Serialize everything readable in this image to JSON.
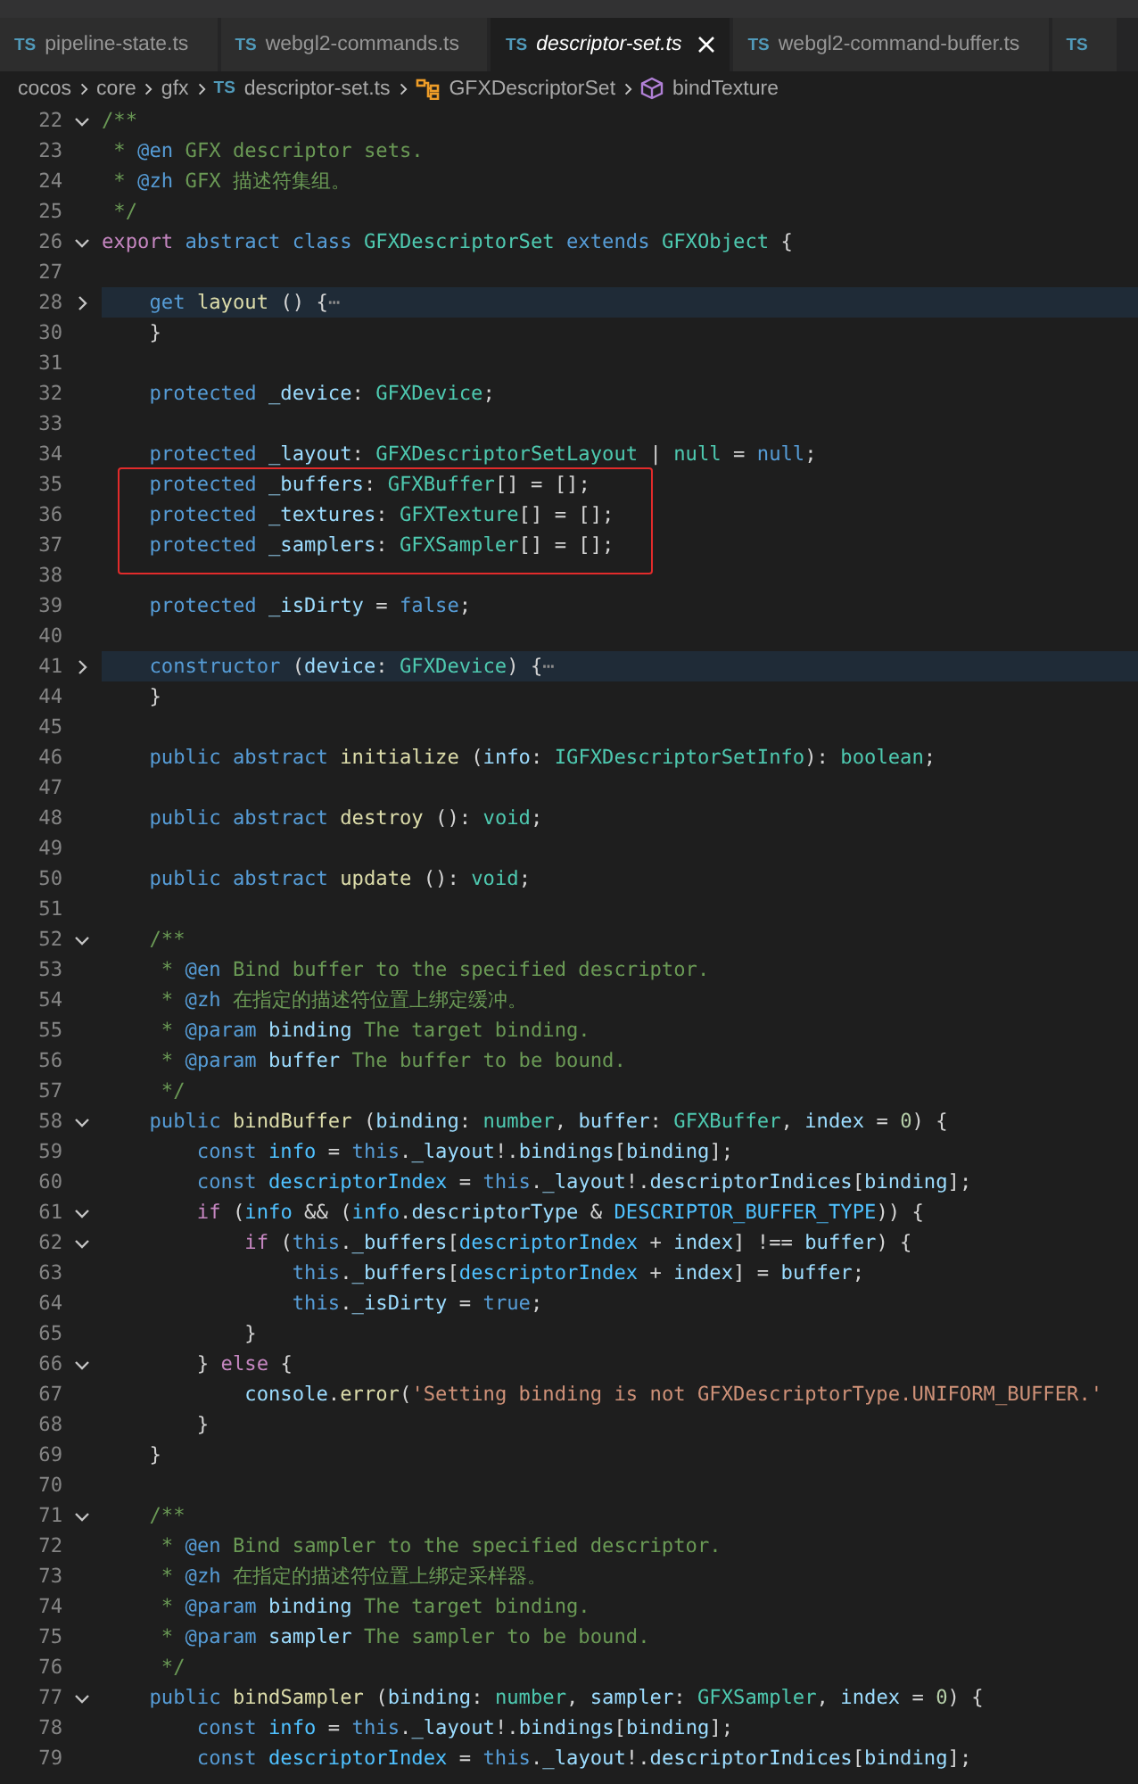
{
  "tabs": [
    {
      "icon": "TS",
      "label": "pipeline-state.ts",
      "selected": false,
      "preview": false
    },
    {
      "icon": "TS",
      "label": "webgl2-commands.ts",
      "selected": false,
      "preview": false
    },
    {
      "icon": "TS",
      "label": "descriptor-set.ts",
      "selected": true,
      "preview": true
    },
    {
      "icon": "TS",
      "label": "webgl2-command-buffer.ts",
      "selected": false,
      "preview": false
    },
    {
      "icon": "TS",
      "selected": false,
      "preview": false
    }
  ],
  "breadcrumb": [
    {
      "kind": "folder",
      "label": "cocos"
    },
    {
      "kind": "folder",
      "label": "core"
    },
    {
      "kind": "folder",
      "label": "gfx"
    },
    {
      "kind": "file",
      "icon": "TS",
      "label": "descriptor-set.ts"
    },
    {
      "kind": "class",
      "label": "GFXDescriptorSet"
    },
    {
      "kind": "method",
      "label": "bindTexture"
    }
  ],
  "lines": [
    {
      "number": "22",
      "expanded": true,
      "tokens": [
        {
          "kind": "comment",
          "text": "/**"
        }
      ]
    },
    {
      "number": "23",
      "tokens": [
        {
          "kind": "comment",
          "text": " * "
        },
        {
          "kind": "doctag",
          "text": "@en"
        },
        {
          "kind": "comment",
          "text": " GFX descriptor sets."
        }
      ]
    },
    {
      "number": "24",
      "tokens": [
        {
          "kind": "comment",
          "text": " * "
        },
        {
          "kind": "doctag",
          "text": "@zh"
        },
        {
          "kind": "comment",
          "text": " GFX 描述符集组。"
        }
      ]
    },
    {
      "number": "25",
      "tokens": [
        {
          "kind": "comment",
          "text": " */"
        }
      ]
    },
    {
      "number": "26",
      "expanded": true,
      "tokens": [
        {
          "kind": "control",
          "text": "export"
        },
        {
          "kind": "keyword",
          "text": " abstract"
        },
        {
          "kind": "keyword",
          "text": " class"
        },
        {
          "kind": "type",
          "text": " GFXDescriptorSet"
        },
        {
          "kind": "keyword",
          "text": " extends"
        },
        {
          "kind": "type",
          "text": " GFXObject"
        },
        {
          "kind": "plain",
          "text": " {"
        }
      ]
    },
    {
      "number": "27"
    },
    {
      "number": "28",
      "expanded": false,
      "highlighted": true,
      "tokens": [
        {
          "kind": "keyword",
          "text": "    get"
        },
        {
          "kind": "function",
          "text": " layout"
        },
        {
          "kind": "plain",
          "text": " () {"
        },
        {
          "kind": "folded",
          "text": "⋯"
        }
      ]
    },
    {
      "number": "30",
      "tokens": [
        {
          "kind": "plain",
          "text": "    }"
        }
      ]
    },
    {
      "number": "31"
    },
    {
      "number": "32",
      "tokens": [
        {
          "kind": "keyword",
          "text": "    protected"
        },
        {
          "kind": "variable",
          "text": " _device"
        },
        {
          "kind": "plain",
          "text": ": "
        },
        {
          "kind": "type",
          "text": "GFXDevice"
        },
        {
          "kind": "plain",
          "text": ";"
        }
      ]
    },
    {
      "number": "33"
    },
    {
      "number": "34",
      "tokens": [
        {
          "kind": "keyword",
          "text": "    protected"
        },
        {
          "kind": "variable",
          "text": " _layout"
        },
        {
          "kind": "plain",
          "text": ": "
        },
        {
          "kind": "type",
          "text": "GFXDescriptorSetLayout"
        },
        {
          "kind": "plain",
          "text": " | "
        },
        {
          "kind": "type",
          "text": "null"
        },
        {
          "kind": "plain",
          "text": " = "
        },
        {
          "kind": "keyword",
          "text": "null"
        },
        {
          "kind": "plain",
          "text": ";"
        }
      ]
    },
    {
      "number": "35",
      "boxed": true,
      "tokens": [
        {
          "kind": "keyword",
          "text": "    protected"
        },
        {
          "kind": "variable",
          "text": " _buffers"
        },
        {
          "kind": "plain",
          "text": ": "
        },
        {
          "kind": "type",
          "text": "GFXBuffer"
        },
        {
          "kind": "plain",
          "text": "[] = [];"
        }
      ]
    },
    {
      "number": "36",
      "boxed": true,
      "tokens": [
        {
          "kind": "keyword",
          "text": "    protected"
        },
        {
          "kind": "variable",
          "text": " _textures"
        },
        {
          "kind": "plain",
          "text": ": "
        },
        {
          "kind": "type",
          "text": "GFXTexture"
        },
        {
          "kind": "plain",
          "text": "[] = [];"
        }
      ]
    },
    {
      "number": "37",
      "boxed": true,
      "tokens": [
        {
          "kind": "keyword",
          "text": "    protected"
        },
        {
          "kind": "variable",
          "text": " _samplers"
        },
        {
          "kind": "plain",
          "text": ": "
        },
        {
          "kind": "type",
          "text": "GFXSampler"
        },
        {
          "kind": "plain",
          "text": "[] = [];"
        }
      ]
    },
    {
      "number": "38"
    },
    {
      "number": "39",
      "tokens": [
        {
          "kind": "keyword",
          "text": "    protected"
        },
        {
          "kind": "variable",
          "text": " _isDirty"
        },
        {
          "kind": "plain",
          "text": " = "
        },
        {
          "kind": "keyword",
          "text": "false"
        },
        {
          "kind": "plain",
          "text": ";"
        }
      ]
    },
    {
      "number": "40"
    },
    {
      "number": "41",
      "expanded": false,
      "highlighted": true,
      "tokens": [
        {
          "kind": "keyword",
          "text": "    constructor"
        },
        {
          "kind": "plain",
          "text": " ("
        },
        {
          "kind": "variable",
          "text": "device"
        },
        {
          "kind": "plain",
          "text": ": "
        },
        {
          "kind": "type",
          "text": "GFXDevice"
        },
        {
          "kind": "plain",
          "text": ") {"
        },
        {
          "kind": "folded",
          "text": "⋯"
        }
      ]
    },
    {
      "number": "44",
      "tokens": [
        {
          "kind": "plain",
          "text": "    }"
        }
      ]
    },
    {
      "number": "45"
    },
    {
      "number": "46",
      "tokens": [
        {
          "kind": "keyword",
          "text": "    public"
        },
        {
          "kind": "keyword",
          "text": " abstract"
        },
        {
          "kind": "function",
          "text": " initialize"
        },
        {
          "kind": "plain",
          "text": " ("
        },
        {
          "kind": "variable",
          "text": "info"
        },
        {
          "kind": "plain",
          "text": ": "
        },
        {
          "kind": "type",
          "text": "IGFXDescriptorSetInfo"
        },
        {
          "kind": "plain",
          "text": "): "
        },
        {
          "kind": "type",
          "text": "boolean"
        },
        {
          "kind": "plain",
          "text": ";"
        }
      ]
    },
    {
      "number": "47"
    },
    {
      "number": "48",
      "tokens": [
        {
          "kind": "keyword",
          "text": "    public"
        },
        {
          "kind": "keyword",
          "text": " abstract"
        },
        {
          "kind": "function",
          "text": " destroy"
        },
        {
          "kind": "plain",
          "text": " (): "
        },
        {
          "kind": "type",
          "text": "void"
        },
        {
          "kind": "plain",
          "text": ";"
        }
      ]
    },
    {
      "number": "49"
    },
    {
      "number": "50",
      "tokens": [
        {
          "kind": "keyword",
          "text": "    public"
        },
        {
          "kind": "keyword",
          "text": " abstract"
        },
        {
          "kind": "function",
          "text": " update"
        },
        {
          "kind": "plain",
          "text": " (): "
        },
        {
          "kind": "type",
          "text": "void"
        },
        {
          "kind": "plain",
          "text": ";"
        }
      ]
    },
    {
      "number": "51"
    },
    {
      "number": "52",
      "expanded": true,
      "tokens": [
        {
          "kind": "comment",
          "text": "    /**"
        }
      ]
    },
    {
      "number": "53",
      "tokens": [
        {
          "kind": "comment",
          "text": "     * "
        },
        {
          "kind": "doctag",
          "text": "@en"
        },
        {
          "kind": "comment",
          "text": " Bind buffer to the specified descriptor."
        }
      ]
    },
    {
      "number": "54",
      "tokens": [
        {
          "kind": "comment",
          "text": "     * "
        },
        {
          "kind": "doctag",
          "text": "@zh"
        },
        {
          "kind": "comment",
          "text": " 在指定的描述符位置上绑定缓冲。"
        }
      ]
    },
    {
      "number": "55",
      "tokens": [
        {
          "kind": "comment",
          "text": "     * "
        },
        {
          "kind": "doctag",
          "text": "@param"
        },
        {
          "kind": "variable",
          "text": " binding"
        },
        {
          "kind": "comment",
          "text": " The target binding."
        }
      ]
    },
    {
      "number": "56",
      "tokens": [
        {
          "kind": "comment",
          "text": "     * "
        },
        {
          "kind": "doctag",
          "text": "@param"
        },
        {
          "kind": "variable",
          "text": " buffer"
        },
        {
          "kind": "comment",
          "text": " The buffer to be bound."
        }
      ]
    },
    {
      "number": "57",
      "tokens": [
        {
          "kind": "comment",
          "text": "     */"
        }
      ]
    },
    {
      "number": "58",
      "expanded": true,
      "tokens": [
        {
          "kind": "keyword",
          "text": "    public"
        },
        {
          "kind": "function",
          "text": " bindBuffer"
        },
        {
          "kind": "plain",
          "text": " ("
        },
        {
          "kind": "variable",
          "text": "binding"
        },
        {
          "kind": "plain",
          "text": ": "
        },
        {
          "kind": "type",
          "text": "number"
        },
        {
          "kind": "plain",
          "text": ", "
        },
        {
          "kind": "variable",
          "text": "buffer"
        },
        {
          "kind": "plain",
          "text": ": "
        },
        {
          "kind": "type",
          "text": "GFXBuffer"
        },
        {
          "kind": "plain",
          "text": ", "
        },
        {
          "kind": "variable",
          "text": "index"
        },
        {
          "kind": "plain",
          "text": " = "
        },
        {
          "kind": "number",
          "text": "0"
        },
        {
          "kind": "plain",
          "text": ") {"
        }
      ]
    },
    {
      "number": "59",
      "tokens": [
        {
          "kind": "keyword",
          "text": "        const"
        },
        {
          "kind": "constant",
          "text": " info"
        },
        {
          "kind": "plain",
          "text": " = "
        },
        {
          "kind": "keyword",
          "text": "this"
        },
        {
          "kind": "plain",
          "text": "."
        },
        {
          "kind": "variable",
          "text": "_layout"
        },
        {
          "kind": "plain",
          "text": "!."
        },
        {
          "kind": "variable",
          "text": "bindings"
        },
        {
          "kind": "plain",
          "text": "["
        },
        {
          "kind": "variable",
          "text": "binding"
        },
        {
          "kind": "plain",
          "text": "];"
        }
      ]
    },
    {
      "number": "60",
      "tokens": [
        {
          "kind": "keyword",
          "text": "        const"
        },
        {
          "kind": "constant",
          "text": " descriptorIndex"
        },
        {
          "kind": "plain",
          "text": " = "
        },
        {
          "kind": "keyword",
          "text": "this"
        },
        {
          "kind": "plain",
          "text": "."
        },
        {
          "kind": "variable",
          "text": "_layout"
        },
        {
          "kind": "plain",
          "text": "!."
        },
        {
          "kind": "variable",
          "text": "descriptorIndices"
        },
        {
          "kind": "plain",
          "text": "["
        },
        {
          "kind": "variable",
          "text": "binding"
        },
        {
          "kind": "plain",
          "text": "];"
        }
      ]
    },
    {
      "number": "61",
      "expanded": true,
      "tokens": [
        {
          "kind": "control",
          "text": "        if"
        },
        {
          "kind": "plain",
          "text": " ("
        },
        {
          "kind": "constant",
          "text": "info"
        },
        {
          "kind": "plain",
          "text": " && ("
        },
        {
          "kind": "constant",
          "text": "info"
        },
        {
          "kind": "plain",
          "text": "."
        },
        {
          "kind": "variable",
          "text": "descriptorType"
        },
        {
          "kind": "plain",
          "text": " & "
        },
        {
          "kind": "constant",
          "text": "DESCRIPTOR_BUFFER_TYPE"
        },
        {
          "kind": "plain",
          "text": ")) {"
        }
      ]
    },
    {
      "number": "62",
      "expanded": true,
      "tokens": [
        {
          "kind": "control",
          "text": "            if"
        },
        {
          "kind": "plain",
          "text": " ("
        },
        {
          "kind": "keyword",
          "text": "this"
        },
        {
          "kind": "plain",
          "text": "."
        },
        {
          "kind": "variable",
          "text": "_buffers"
        },
        {
          "kind": "plain",
          "text": "["
        },
        {
          "kind": "constant",
          "text": "descriptorIndex"
        },
        {
          "kind": "plain",
          "text": " + "
        },
        {
          "kind": "variable",
          "text": "index"
        },
        {
          "kind": "plain",
          "text": "] !== "
        },
        {
          "kind": "variable",
          "text": "buffer"
        },
        {
          "kind": "plain",
          "text": ") {"
        }
      ]
    },
    {
      "number": "63",
      "tokens": [
        {
          "kind": "keyword",
          "text": "                this"
        },
        {
          "kind": "plain",
          "text": "."
        },
        {
          "kind": "variable",
          "text": "_buffers"
        },
        {
          "kind": "plain",
          "text": "["
        },
        {
          "kind": "constant",
          "text": "descriptorIndex"
        },
        {
          "kind": "plain",
          "text": " + "
        },
        {
          "kind": "variable",
          "text": "index"
        },
        {
          "kind": "plain",
          "text": "] = "
        },
        {
          "kind": "variable",
          "text": "buffer"
        },
        {
          "kind": "plain",
          "text": ";"
        }
      ]
    },
    {
      "number": "64",
      "tokens": [
        {
          "kind": "keyword",
          "text": "                this"
        },
        {
          "kind": "plain",
          "text": "."
        },
        {
          "kind": "variable",
          "text": "_isDirty"
        },
        {
          "kind": "plain",
          "text": " = "
        },
        {
          "kind": "keyword",
          "text": "true"
        },
        {
          "kind": "plain",
          "text": ";"
        }
      ]
    },
    {
      "number": "65",
      "tokens": [
        {
          "kind": "plain",
          "text": "            }"
        }
      ]
    },
    {
      "number": "66",
      "expanded": true,
      "tokens": [
        {
          "kind": "plain",
          "text": "        }"
        },
        {
          "kind": "control",
          "text": " else"
        },
        {
          "kind": "plain",
          "text": " {"
        }
      ]
    },
    {
      "number": "67",
      "tokens": [
        {
          "kind": "variable",
          "text": "            console"
        },
        {
          "kind": "plain",
          "text": "."
        },
        {
          "kind": "function",
          "text": "error"
        },
        {
          "kind": "plain",
          "text": "("
        },
        {
          "kind": "string",
          "text": "'Setting binding is not GFXDescriptorType.UNIFORM_BUFFER.'"
        }
      ]
    },
    {
      "number": "68",
      "tokens": [
        {
          "kind": "plain",
          "text": "        }"
        }
      ]
    },
    {
      "number": "69",
      "tokens": [
        {
          "kind": "plain",
          "text": "    }"
        }
      ]
    },
    {
      "number": "70"
    },
    {
      "number": "71",
      "expanded": true,
      "tokens": [
        {
          "kind": "comment",
          "text": "    /**"
        }
      ]
    },
    {
      "number": "72",
      "tokens": [
        {
          "kind": "comment",
          "text": "     * "
        },
        {
          "kind": "doctag",
          "text": "@en"
        },
        {
          "kind": "comment",
          "text": " Bind sampler to the specified descriptor."
        }
      ]
    },
    {
      "number": "73",
      "tokens": [
        {
          "kind": "comment",
          "text": "     * "
        },
        {
          "kind": "doctag",
          "text": "@zh"
        },
        {
          "kind": "comment",
          "text": " 在指定的描述符位置上绑定采样器。"
        }
      ]
    },
    {
      "number": "74",
      "tokens": [
        {
          "kind": "comment",
          "text": "     * "
        },
        {
          "kind": "doctag",
          "text": "@param"
        },
        {
          "kind": "variable",
          "text": " binding"
        },
        {
          "kind": "comment",
          "text": " The target binding."
        }
      ]
    },
    {
      "number": "75",
      "tokens": [
        {
          "kind": "comment",
          "text": "     * "
        },
        {
          "kind": "doctag",
          "text": "@param"
        },
        {
          "kind": "variable",
          "text": " sampler"
        },
        {
          "kind": "comment",
          "text": " The sampler to be bound."
        }
      ]
    },
    {
      "number": "76",
      "tokens": [
        {
          "kind": "comment",
          "text": "     */"
        }
      ]
    },
    {
      "number": "77",
      "expanded": true,
      "tokens": [
        {
          "kind": "keyword",
          "text": "    public"
        },
        {
          "kind": "function",
          "text": " bindSampler"
        },
        {
          "kind": "plain",
          "text": " ("
        },
        {
          "kind": "variable",
          "text": "binding"
        },
        {
          "kind": "plain",
          "text": ": "
        },
        {
          "kind": "type",
          "text": "number"
        },
        {
          "kind": "plain",
          "text": ", "
        },
        {
          "kind": "variable",
          "text": "sampler"
        },
        {
          "kind": "plain",
          "text": ": "
        },
        {
          "kind": "type",
          "text": "GFXSampler"
        },
        {
          "kind": "plain",
          "text": ", "
        },
        {
          "kind": "variable",
          "text": "index"
        },
        {
          "kind": "plain",
          "text": " = "
        },
        {
          "kind": "number",
          "text": "0"
        },
        {
          "kind": "plain",
          "text": ") {"
        }
      ]
    },
    {
      "number": "78",
      "tokens": [
        {
          "kind": "keyword",
          "text": "        const"
        },
        {
          "kind": "constant",
          "text": " info"
        },
        {
          "kind": "plain",
          "text": " = "
        },
        {
          "kind": "keyword",
          "text": "this"
        },
        {
          "kind": "plain",
          "text": "."
        },
        {
          "kind": "variable",
          "text": "_layout"
        },
        {
          "kind": "plain",
          "text": "!."
        },
        {
          "kind": "variable",
          "text": "bindings"
        },
        {
          "kind": "plain",
          "text": "["
        },
        {
          "kind": "variable",
          "text": "binding"
        },
        {
          "kind": "plain",
          "text": "];"
        }
      ]
    },
    {
      "number": "79",
      "tokens": [
        {
          "kind": "keyword",
          "text": "        const"
        },
        {
          "kind": "constant",
          "text": " descriptorIndex"
        },
        {
          "kind": "plain",
          "text": " = "
        },
        {
          "kind": "keyword",
          "text": "this"
        },
        {
          "kind": "plain",
          "text": "."
        },
        {
          "kind": "variable",
          "text": "_layout"
        },
        {
          "kind": "plain",
          "text": "!."
        },
        {
          "kind": "variable",
          "text": "descriptorIndices"
        },
        {
          "kind": "plain",
          "text": "["
        },
        {
          "kind": "variable",
          "text": "binding"
        },
        {
          "kind": "plain",
          "text": "];"
        }
      ]
    }
  ]
}
